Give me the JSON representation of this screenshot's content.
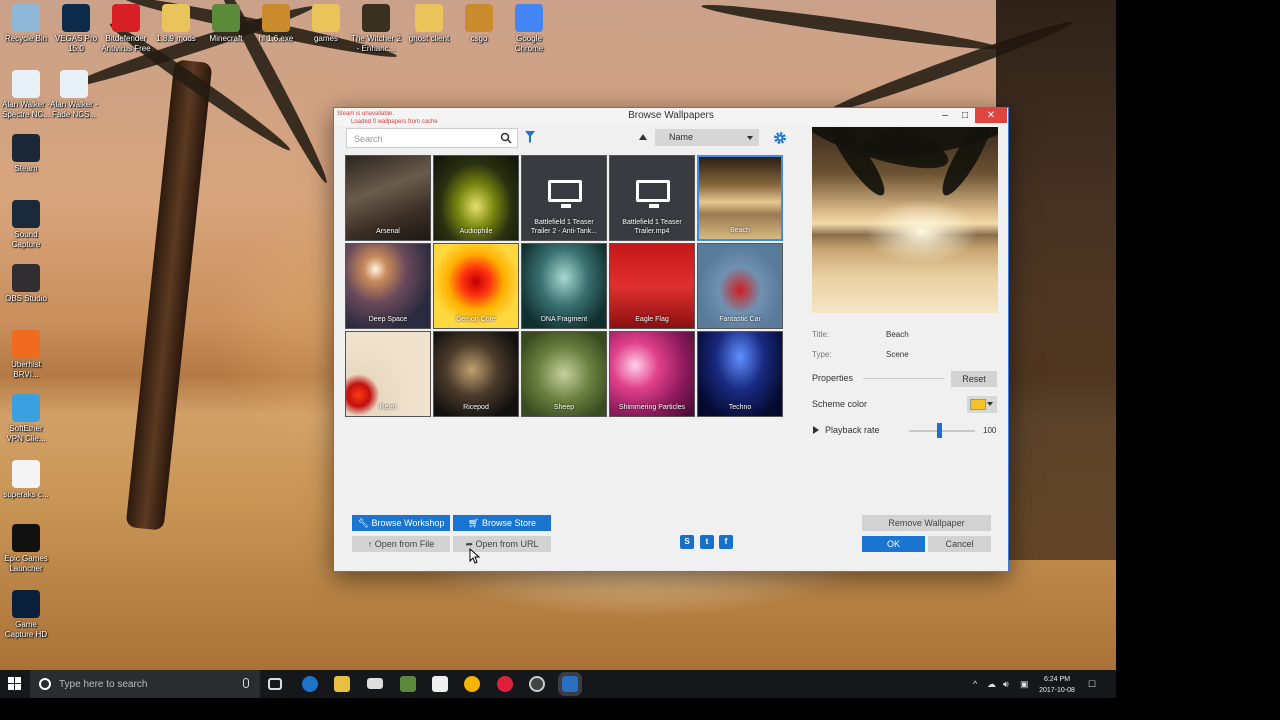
{
  "desktop_icons": [
    {
      "label": "Recycle Bin",
      "icon": "recycle-bin-icon",
      "color": "#8fb8d8"
    },
    {
      "label": "VEGAS Pro 15.0",
      "icon": "vegas-icon",
      "color": "#0d2b4a"
    },
    {
      "label": "Bitdefender Antivirus Free",
      "icon": "bitdefender-icon",
      "color": "#d81f26"
    },
    {
      "label": "1.8.9 mods",
      "icon": "folder-icon",
      "color": "#e8c45a"
    },
    {
      "label": "Minecraft",
      "icon": "minecraft-icon",
      "color": "#5a8a3a"
    },
    {
      "label": "hl 1.6.exe",
      "icon": "csgo-icon",
      "color": "#c98b2c"
    },
    {
      "label": "games",
      "icon": "folder-icon",
      "color": "#e8c45a"
    },
    {
      "label": "The Witcher 2 - Enhanc...",
      "icon": "witcher-icon",
      "color": "#3a3020"
    },
    {
      "label": "ghost client",
      "icon": "folder-icon",
      "color": "#e8c45a"
    },
    {
      "label": "csgo",
      "icon": "csgo-icon",
      "color": "#c98b2c"
    },
    {
      "label": "Google Chrome",
      "icon": "chrome-icon",
      "color": "#4285f4"
    },
    {
      "label": "Alan Walker - Spectre NC...",
      "icon": "audio-file-icon",
      "color": "#e8f0f8"
    },
    {
      "label": "Alan Walker - Fade NCS...",
      "icon": "audio-file-icon",
      "color": "#e8f0f8"
    },
    {
      "label": "Steam",
      "icon": "steam-icon",
      "color": "#1b2838"
    },
    {
      "label": "Sound Capture",
      "icon": "sound-capture-icon",
      "color": "#1a2a3a"
    },
    {
      "label": "OBS Studio",
      "icon": "obs-icon",
      "color": "#302e31"
    },
    {
      "label": "Uberhist BRVI...",
      "icon": "swirl-icon",
      "color": "#f06a20"
    },
    {
      "label": "SoftEther VPN Clie...",
      "icon": "vpn-icon",
      "color": "#3aa0e0"
    },
    {
      "label": "superaks c...",
      "icon": "text-file-icon",
      "color": "#f4f4f4"
    },
    {
      "label": "Epic Games Launcher",
      "icon": "epic-icon",
      "color": "#111111"
    },
    {
      "label": "Game Capture HD",
      "icon": "game-capture-icon",
      "color": "#0a1f3a"
    }
  ],
  "window": {
    "title": "Browse Wallpapers",
    "warning_line1": "Steam is unavailable.",
    "warning_line2": "Loaded 0 wallpapers from cache",
    "minimize": "–",
    "maximize": "□",
    "close": "✕"
  },
  "toolbar": {
    "search_placeholder": "Search",
    "sort_value": "Name"
  },
  "wallpapers": [
    {
      "title": "Arsenal",
      "selected": false,
      "bg": "linear-gradient(160deg,#2a2420,#6a5c4c 40%,#3c3028 70%,#1c1814)"
    },
    {
      "title": "Audiophile",
      "selected": false,
      "bg": "radial-gradient(ellipse at 50% 60%,#e8e070,#7a8a10 30%,#2a3010 60%,#101208)"
    },
    {
      "title": "Battlefield 1 Teaser Trailer 2 - Anti-Tank...",
      "selected": false,
      "bg": "#3a3b40",
      "monitor": true
    },
    {
      "title": "Battlefield 1 Teaser Trailer.mp4",
      "selected": false,
      "bg": "#3a3b40",
      "monitor": true
    },
    {
      "title": "Beach",
      "selected": true,
      "bg": "linear-gradient(180deg,#2a1e12,#8a6a3e 35%,#e8c890 55%,#9a7a50 70%,#d8b880)"
    },
    {
      "title": "Deep Space",
      "selected": false,
      "bg": "radial-gradient(ellipse at 35% 30%,#fff4e0,#c88a5a 15%,#6a4a5a 40%,#2a2a40 75%)"
    },
    {
      "title": "Demon Core",
      "selected": false,
      "bg": "radial-gradient(circle at 50% 45%,#c00000,#ff3010 22%,#ffb000 45%,#ffd840 70%)"
    },
    {
      "title": "DNA Fragment",
      "selected": false,
      "bg": "radial-gradient(ellipse at 50% 40%,#a8d8d0,#3a7070 40%,#10302e 80%)"
    },
    {
      "title": "Eagle Flag",
      "selected": false,
      "bg": "linear-gradient(180deg,#c41818,#e03030 50%,#8a1010)"
    },
    {
      "title": "Fantastic Car",
      "selected": false,
      "bg": "radial-gradient(ellipse at 50% 55%,#d02020,#7090b0 35%,#5a7a9a 70%)"
    },
    {
      "title": "Retro",
      "selected": false,
      "bg": "radial-gradient(circle at 15% 75%,#ff3a10,#c01010 12%,#e8d8c0 22%,#f0e2cc 60%)"
    },
    {
      "title": "Ricepod",
      "selected": false,
      "bg": "radial-gradient(ellipse at 45% 45%,#c0a070,#4a3a2a 40%,#101010 80%)"
    },
    {
      "title": "Sheep",
      "selected": false,
      "bg": "radial-gradient(ellipse at 50% 50%,#c8d0a0,#6a8040 45%,#3a4a20 85%)"
    },
    {
      "title": "Shimmering Particles",
      "selected": false,
      "bg": "radial-gradient(circle at 30% 40%,#ffd0e8,#e0408a 30%,#8a1a5a 65%,#400a30)"
    },
    {
      "title": "Techno",
      "selected": false,
      "bg": "radial-gradient(ellipse at 50% 30%,#6090ff,#1a2a80 40%,#060a30 80%)"
    }
  ],
  "details": {
    "title_label": "Title:",
    "title_value": "Beach",
    "type_label": "Type:",
    "type_value": "Scene",
    "properties_label": "Properties",
    "reset_label": "Reset",
    "scheme_color_label": "Scheme color",
    "scheme_color": "#f5c028",
    "playback_rate_label": "Playback rate",
    "playback_rate_value": "100"
  },
  "buttons": {
    "browse_workshop": "Browse Workshop",
    "browse_store": "Browse Store",
    "open_from_file": "Open from File",
    "open_from_url": "Open from URL",
    "remove_wallpaper": "Remove Wallpaper",
    "ok": "OK",
    "cancel": "Cancel"
  },
  "taskbar": {
    "search_placeholder": "Type here to search",
    "time": "6:24 PM",
    "date": "2017-10-08"
  },
  "colors": {
    "accent": "#1a74d1",
    "selection_border": "#3a8ee6",
    "close_red": "#e0443e"
  }
}
